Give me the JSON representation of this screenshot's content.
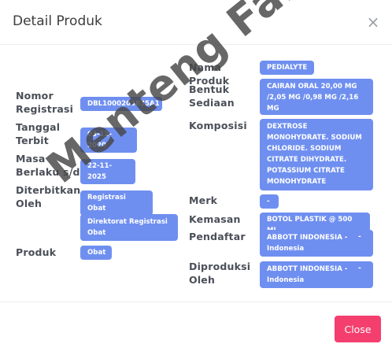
{
  "modal": {
    "title": "Detail Produk",
    "close_icon": "close-icon",
    "close_button": "Close"
  },
  "fields": {
    "nomor_registrasi": {
      "label": "Nomor Registrasi",
      "value": "DBL1000203835A1"
    },
    "tanggal_terbit": {
      "label": "Tanggal Terbit",
      "value": "03-12-2020"
    },
    "masa_berlaku": {
      "label": "Masa Berlaku s/d",
      "value": "22-11-2025"
    },
    "diterbitkan_oleh": {
      "label": "Diterbitkan Oleh",
      "value": "Registrasi Obat",
      "value2": "Direktorat Registrasi Obat"
    },
    "produk": {
      "label": "Produk",
      "value": "Obat"
    },
    "nama_produk": {
      "label": "Nama Produk",
      "value": "PEDIALYTE"
    },
    "bentuk_sediaan": {
      "label": "Bentuk Sediaan",
      "value": "CAIRAN ORAL 20,00 MG /2,05 MG /0,98 MG /2,16 MG"
    },
    "komposisi": {
      "label": "Komposisi",
      "value": "DEXTROSE MONOHYDRATE. SODIUM CHLORIDE. SODIUM CITRATE DIHYDRATE. POTASSIUM CITRATE MONOHYDRATE"
    },
    "merk": {
      "label": "Merk",
      "value": "-"
    },
    "kemasan": {
      "label": "Kemasan",
      "value": "BOTOL PLASTIK @ 500 ML"
    },
    "pendaftar": {
      "label": "Pendaftar",
      "value": "ABBOTT INDONESIA - Indonesia",
      "dash": "-"
    },
    "diproduksi_oleh": {
      "label": "Diproduksi Oleh",
      "value": "ABBOTT INDONESIA - Indonesia",
      "dash": "-"
    }
  },
  "watermark": "Menteng Farma",
  "colors": {
    "badge": "#6f8ff0",
    "close_button": "#f43f6e"
  }
}
